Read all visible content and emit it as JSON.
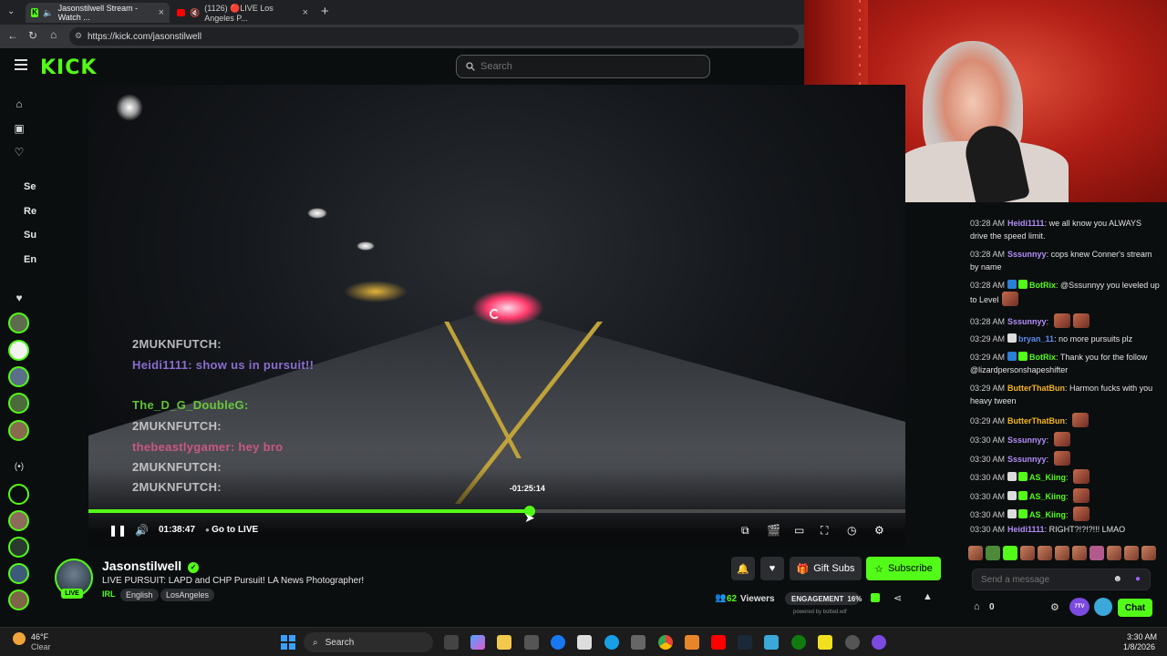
{
  "browser": {
    "tabs": [
      {
        "label": "Jasonstilwell Stream - Watch ..."
      },
      {
        "label": "(1126) 🔴LIVE Los Angeles P..."
      }
    ],
    "url": "https://kick.com/jasonstilwell",
    "new_tab": "+"
  },
  "header": {
    "logo": "KICK",
    "search_placeholder": "Search"
  },
  "sidebar": {
    "section_labels": [
      "Se",
      "Re",
      "Su",
      "En"
    ]
  },
  "video": {
    "overlay_chat": [
      "2MUKNFUTCH:",
      "Heidi1111: show us in pursuit!!",
      "The_D_G_DoubleG:",
      "2MUKNFUTCH:",
      "thebeastlygamer: hey bro",
      "2MUKNFUTCH:",
      "2MUKNFUTCH:"
    ],
    "seek_tooltip": "-01:25:14",
    "progress_fraction": 0.54,
    "current_time": "01:38:47",
    "go_live_label": "Go to LIVE"
  },
  "chat": {
    "messages": [
      {
        "time": "03:28 AM",
        "user": "Heidi1111",
        "color": "#b18cf7",
        "text": "we all know you ALWAYS drive the speed limit."
      },
      {
        "time": "03:28 AM",
        "user": "Sssunnyy",
        "color": "#b18cf7",
        "text": "cops knew Conner's stream by name"
      },
      {
        "time": "03:28 AM",
        "user": "BotRix",
        "color": "#53fc18",
        "text": "@Sssunnyy you leveled up to Level"
      },
      {
        "time": "03:28 AM",
        "user": "Sssunnyy",
        "color": "#b18cf7",
        "text": ""
      },
      {
        "time": "03:29 AM",
        "user": "bryan_11",
        "color": "#5b8cf0",
        "text": "no more pursuits plz"
      },
      {
        "time": "03:29 AM",
        "user": "BotRix",
        "color": "#53fc18",
        "text": "Thank you for the follow @lizardpersonshapeshifter"
      },
      {
        "time": "03:29 AM",
        "user": "ButterThatBun",
        "color": "#f5b51d",
        "text": "Harmon fucks with you heavy tween"
      },
      {
        "time": "03:29 AM",
        "user": "ButterThatBun",
        "color": "#f5b51d",
        "text": ""
      },
      {
        "time": "03:30 AM",
        "user": "Sssunnyy",
        "color": "#b18cf7",
        "text": ""
      },
      {
        "time": "03:30 AM",
        "user": "Sssunnyy",
        "color": "#b18cf7",
        "text": ""
      },
      {
        "time": "03:30 AM",
        "user": "AS_Kiing",
        "color": "#53fc18",
        "text": ""
      },
      {
        "time": "03:30 AM",
        "user": "AS_Kiing",
        "color": "#53fc18",
        "text": ""
      },
      {
        "time": "03:30 AM",
        "user": "AS_Kiing",
        "color": "#53fc18",
        "text": ""
      },
      {
        "time": "03:30 AM",
        "user": "Heidi1111",
        "color": "#b18cf7",
        "text": "RIGHT?!?!?!!! LMAO"
      }
    ],
    "input_placeholder": "Send a message",
    "points": "0",
    "chat_button": "Chat",
    "badge_7tv": "7TV"
  },
  "stream": {
    "streamer_name": "Jasonstilwell",
    "live_badge": "LIVE",
    "title": "LIVE PURSUIT: LAPD and CHP Pursuit! LA News Photographer!",
    "category": "IRL",
    "tags": [
      "English",
      "LosAngeles"
    ],
    "gift_subs_label": "Gift Subs",
    "subscribe_label": "Subscribe",
    "viewers_count": "62",
    "viewers_label": "Viewers",
    "engagement_label": "ENGAGEMENT",
    "engagement_value": "16%",
    "powered_by": "powered by botted.wtf"
  },
  "taskbar": {
    "weather_temp": "46°F",
    "weather_text": "Clear",
    "search_label": "Search",
    "time": "3:30 AM",
    "date": "1/8/2026"
  },
  "colors": {
    "kick_green": "#53fc18",
    "background": "#0b0e0f"
  }
}
